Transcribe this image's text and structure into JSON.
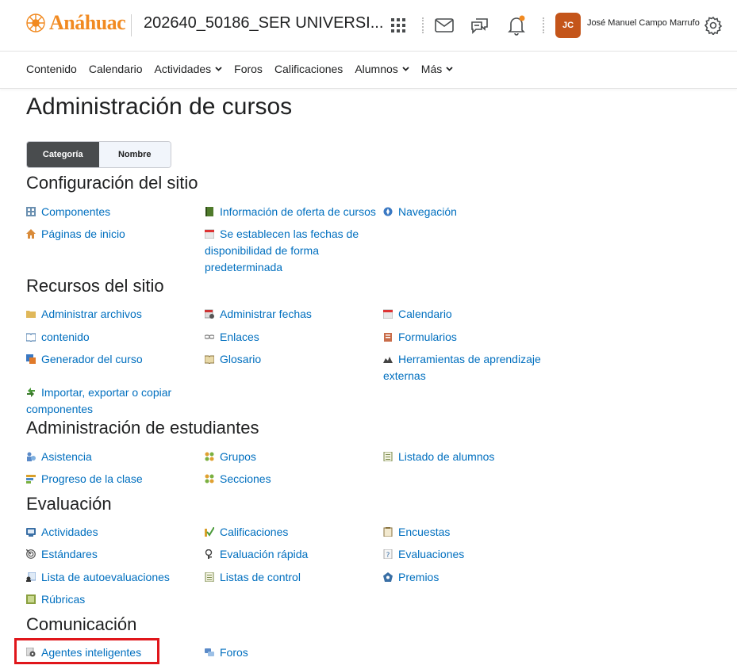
{
  "header": {
    "logo_text": "Anáhuac",
    "course_title": "202640_50186_SER UNIVERSI...",
    "avatar_initials": "JC",
    "user_name": "José Manuel Campo Marrufo",
    "icons": [
      "grid-icon",
      "mail-icon",
      "chat-icon",
      "bell-icon",
      "gear-icon"
    ],
    "colors": {
      "brand": "#f18a21",
      "avatar": "#c4551a",
      "notification": "#f18a21"
    }
  },
  "nav": {
    "items": [
      {
        "label": "Contenido"
      },
      {
        "label": "Calendario"
      },
      {
        "label": "Actividades"
      },
      {
        "label": "Foros"
      },
      {
        "label": "Calificaciones"
      },
      {
        "label": "Alumnos"
      },
      {
        "label": "Más"
      }
    ]
  },
  "page": {
    "title": "Administración de cursos",
    "toggle": {
      "active": "Categoría",
      "inactive": "Nombre"
    }
  },
  "sections": {
    "config": {
      "title": "Configuración del sitio",
      "tools": [
        {
          "label": "Componentes",
          "icon": "components-icon"
        },
        {
          "label": "Información de oferta de cursos",
          "icon": "book-icon"
        },
        {
          "label": "Navegación",
          "icon": "compass-icon"
        },
        {
          "label": "Páginas de inicio",
          "icon": "home-icon"
        },
        {
          "label": "Se establecen las fechas de disponibilidad de forma predeterminada",
          "icon": "calendar-icon"
        }
      ]
    },
    "resources": {
      "title": "Recursos del sitio",
      "tools": [
        {
          "label": "Administrar archivos",
          "icon": "folder-icon"
        },
        {
          "label": "Administrar fechas",
          "icon": "calendar-gear-icon"
        },
        {
          "label": "Calendario",
          "icon": "calendar-icon"
        },
        {
          "label": "contenido",
          "icon": "open-book-icon"
        },
        {
          "label": "Enlaces",
          "icon": "link-icon"
        },
        {
          "label": "Formularios",
          "icon": "forms-icon"
        },
        {
          "label": "Generador del curso",
          "icon": "builder-icon"
        },
        {
          "label": "Glosario",
          "icon": "glossary-icon"
        },
        {
          "label": "Herramientas de aprendizaje externas",
          "icon": "external-tools-icon"
        },
        {
          "label": "Importar, exportar o copiar componentes",
          "icon": "import-export-icon"
        }
      ]
    },
    "students": {
      "title": "Administración de estudiantes",
      "tools": [
        {
          "label": "Asistencia",
          "icon": "attendance-icon"
        },
        {
          "label": "Grupos",
          "icon": "groups-icon"
        },
        {
          "label": "Listado de alumnos",
          "icon": "roster-icon"
        },
        {
          "label": "Progreso de la clase",
          "icon": "progress-icon"
        },
        {
          "label": "Secciones",
          "icon": "sections-icon"
        }
      ]
    },
    "evaluation": {
      "title": "Evaluación",
      "tools": [
        {
          "label": "Actividades",
          "icon": "activities-icon"
        },
        {
          "label": "Calificaciones",
          "icon": "grades-icon"
        },
        {
          "label": "Encuestas",
          "icon": "survey-icon"
        },
        {
          "label": "Estándares",
          "icon": "standards-icon"
        },
        {
          "label": "Evaluación rápida",
          "icon": "quick-eval-icon"
        },
        {
          "label": "Evaluaciones",
          "icon": "quiz-icon"
        },
        {
          "label": "Lista de autoevaluaciones",
          "icon": "self-assess-icon"
        },
        {
          "label": "Listas de control",
          "icon": "checklist-icon"
        },
        {
          "label": "Premios",
          "icon": "award-icon"
        },
        {
          "label": "Rúbricas",
          "icon": "rubric-icon"
        }
      ]
    },
    "communication": {
      "title": "Comunicación",
      "tools": [
        {
          "label": "Agentes inteligentes",
          "icon": "agent-gear-icon"
        },
        {
          "label": "Foros",
          "icon": "discussion-icon"
        }
      ]
    }
  }
}
